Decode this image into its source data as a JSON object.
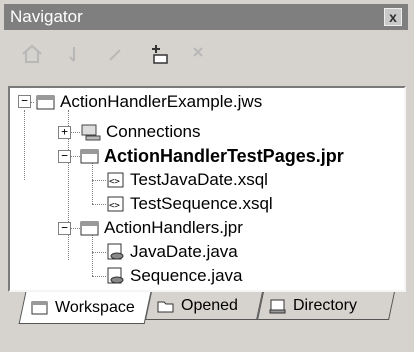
{
  "window": {
    "title": "Navigator",
    "close_label": "x"
  },
  "toolbar": {
    "icons": [
      "home-icon",
      "down-icon",
      "check-icon",
      "add-icon",
      "remove-icon"
    ]
  },
  "tree": {
    "workspace": "ActionHandlerExample.jws",
    "connections": "Connections",
    "project1": "ActionHandlerTestPages.jpr",
    "file1": "TestJavaDate.xsql",
    "file2": "TestSequence.xsql",
    "project2": "ActionHandlers.jpr",
    "file3": "JavaDate.java",
    "file4": "Sequence.java",
    "expand_minus": "−",
    "expand_plus": "+"
  },
  "tabs": [
    {
      "label": "Workspace",
      "active": true
    },
    {
      "label": "Opened",
      "active": false
    },
    {
      "label": "Directory",
      "active": false
    }
  ],
  "colors": {
    "titlebar": "#7f7f7f",
    "panel": "#d6d3ce"
  }
}
